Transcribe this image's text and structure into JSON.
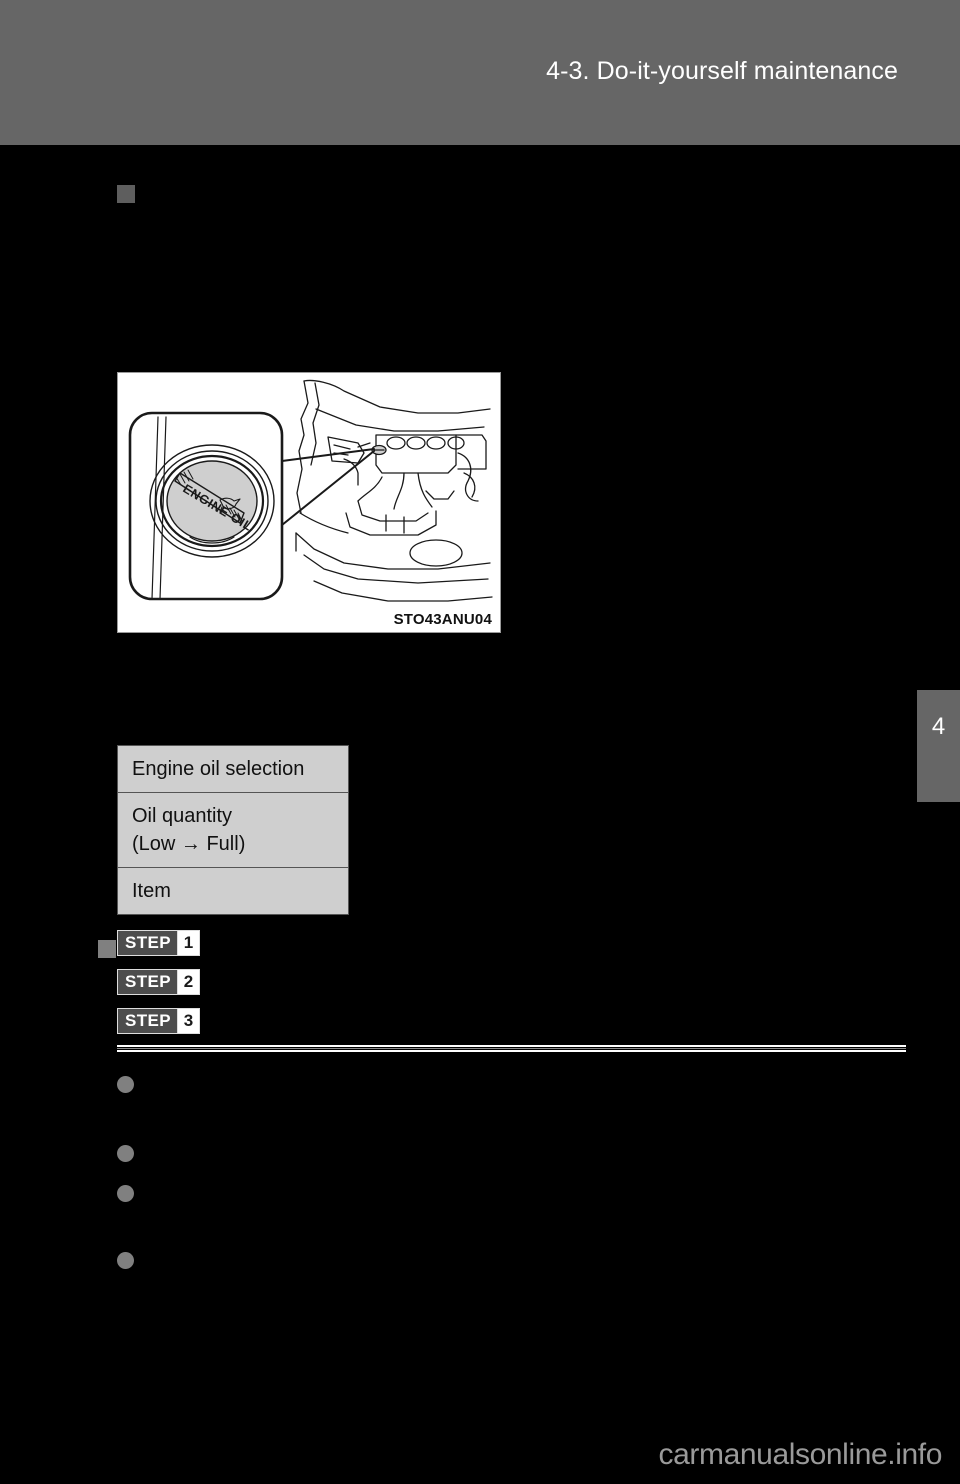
{
  "header": {
    "section_title": "4-3. Do-it-yourself maintenance"
  },
  "chapter_tab": {
    "number": "4"
  },
  "figure": {
    "code": "STO43ANU04",
    "cap_label_line1": "ENGINE OIL",
    "alt": "engine-oil-filler-cap-location-illustration"
  },
  "spec_table": {
    "rows": [
      {
        "label": "Engine oil selection"
      },
      {
        "label": "Oil quantity\n(Low → Full)",
        "line1": "Oil quantity",
        "line2": "(Low → Full)"
      },
      {
        "label": "Item"
      }
    ]
  },
  "steps": [
    {
      "word": "STEP",
      "number": "1"
    },
    {
      "word": "STEP",
      "number": "2"
    },
    {
      "word": "STEP",
      "number": "3"
    }
  ],
  "bullets": [
    {
      "id": "bullet-1"
    },
    {
      "id": "bullet-2"
    },
    {
      "id": "bullet-3"
    },
    {
      "id": "bullet-4"
    }
  ],
  "footer": {
    "watermark": "carmanualsonline.info"
  }
}
